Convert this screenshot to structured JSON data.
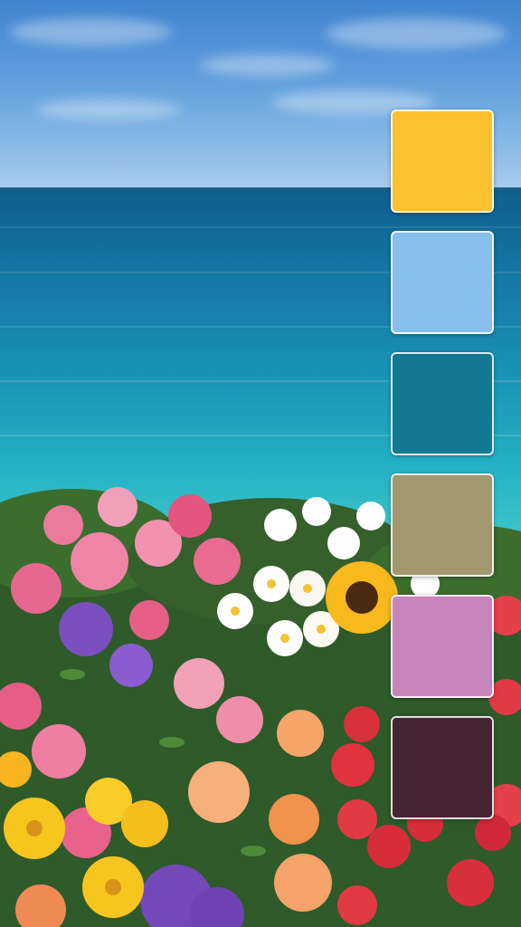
{
  "palette": {
    "swatches": [
      {
        "name": "sunflower-yellow",
        "color": "#FCC12F"
      },
      {
        "name": "sky-blue",
        "color": "#88BFEC"
      },
      {
        "name": "deep-teal",
        "color": "#137891"
      },
      {
        "name": "khaki",
        "color": "#A39770"
      },
      {
        "name": "orchid-pink",
        "color": "#C885BB"
      },
      {
        "name": "dark-plum",
        "color": "#472434"
      }
    ]
  },
  "scene": {
    "sky_color": "#5E9DDC",
    "sea_color": "#1A94B8",
    "flowers": [
      "pink-roses",
      "white-daisies",
      "sunflower",
      "purple-flowers",
      "yellow-daisies",
      "peach-roses",
      "red-roses"
    ]
  }
}
